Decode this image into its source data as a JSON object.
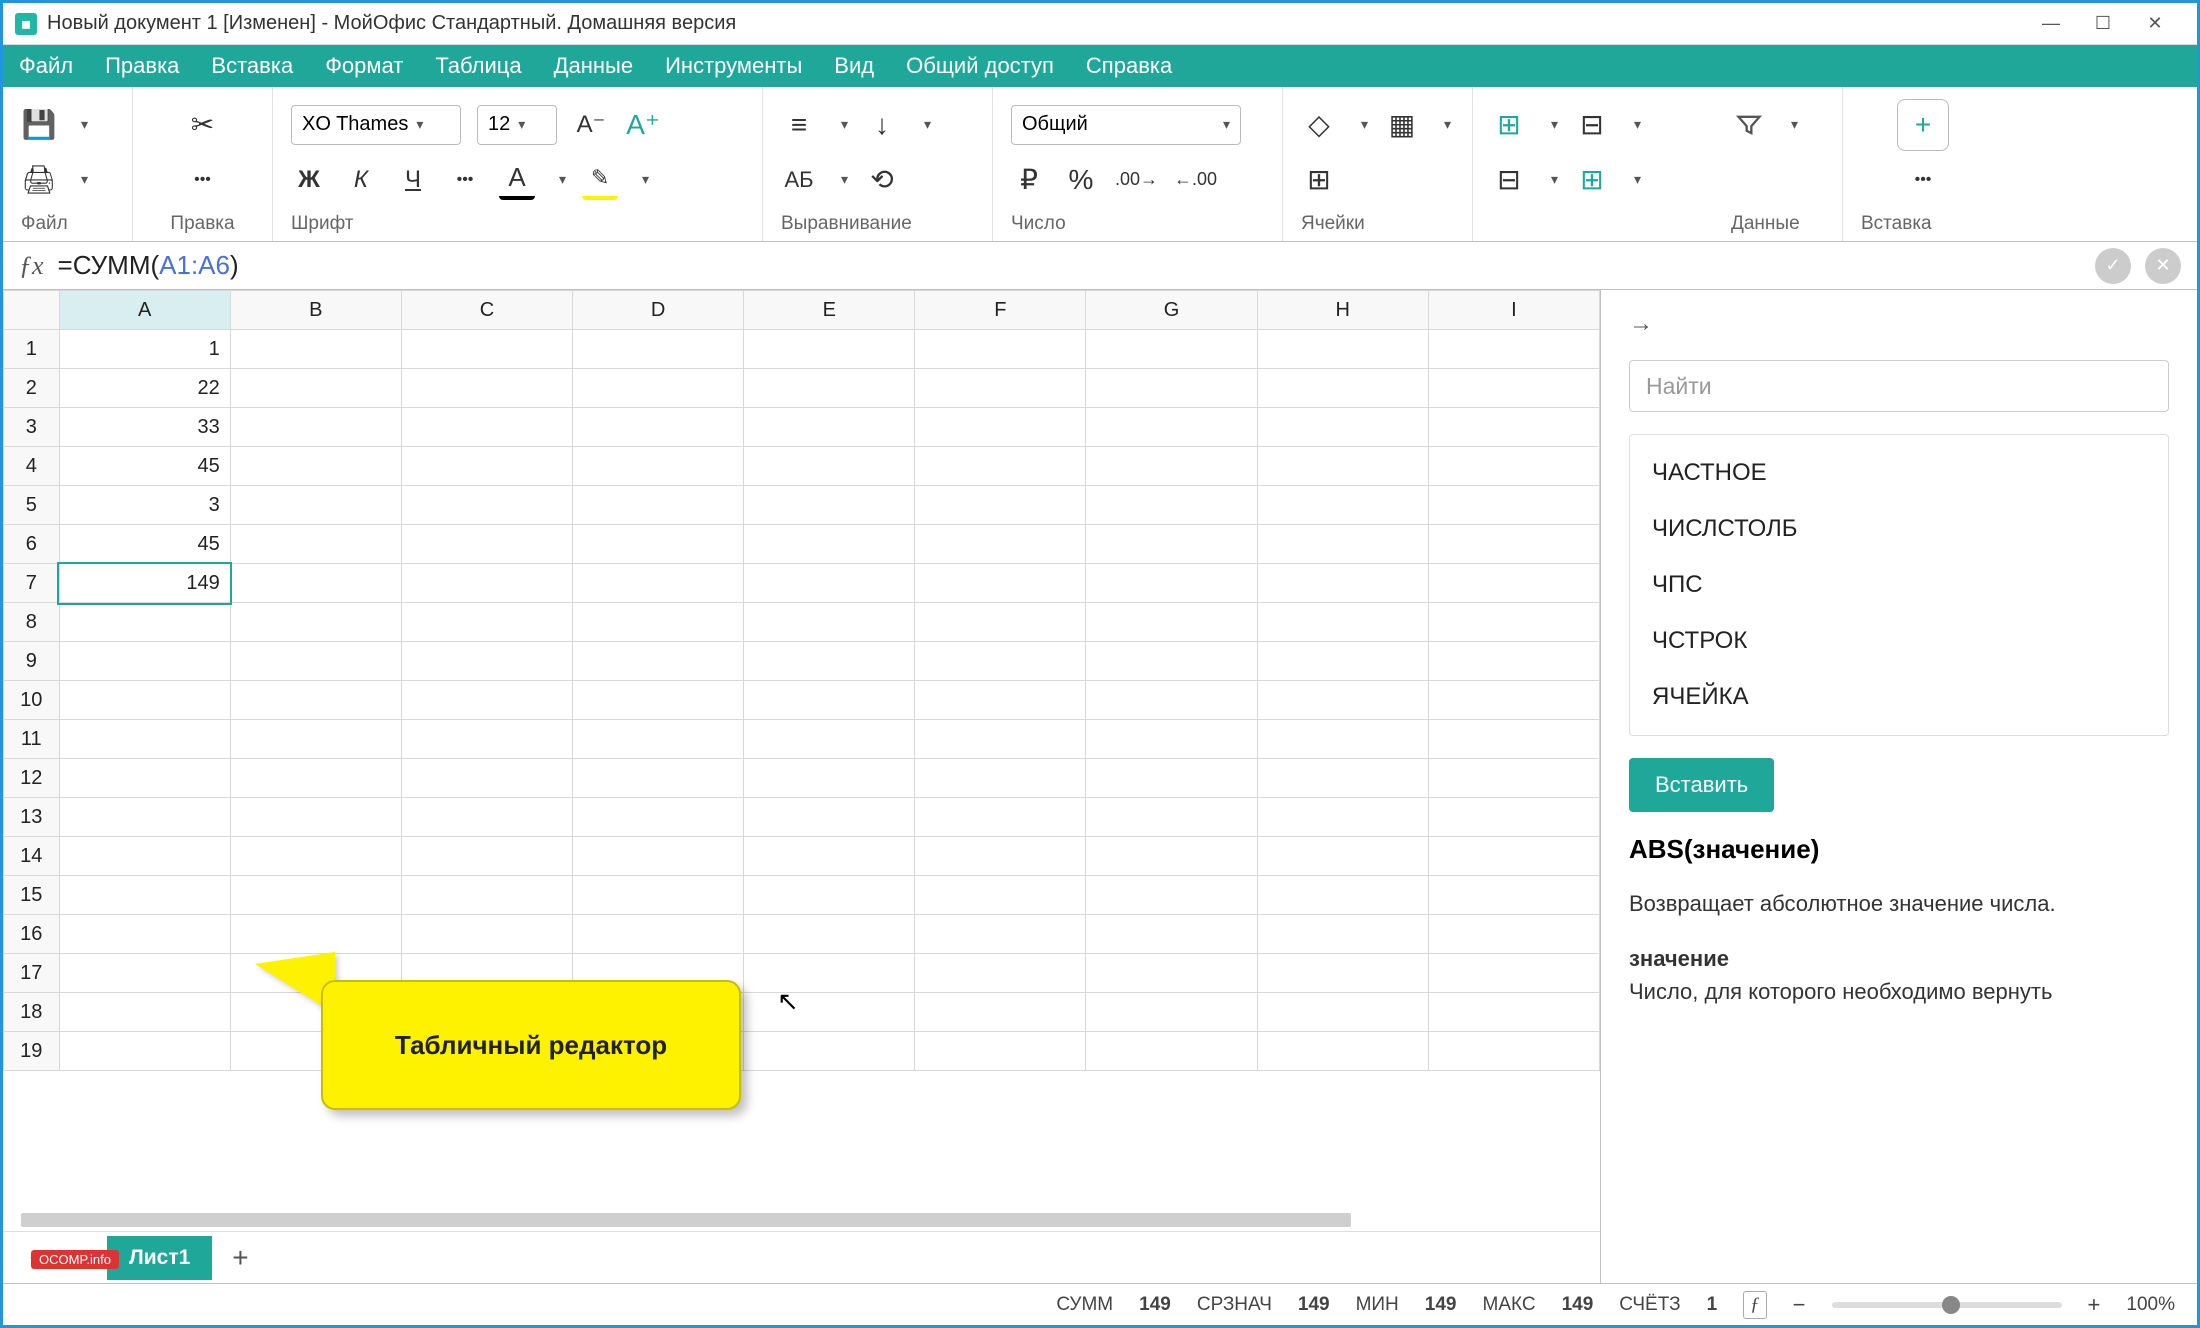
{
  "title": "Новый документ 1 [Изменен] - МойОфис Стандартный. Домашняя версия",
  "menu": [
    "Файл",
    "Правка",
    "Вставка",
    "Формат",
    "Таблица",
    "Данные",
    "Инструменты",
    "Вид",
    "Общий доступ",
    "Справка"
  ],
  "toolbar": {
    "groups": {
      "file": "Файл",
      "edit": "Правка",
      "font": "Шрифт",
      "align": "Выравнивание",
      "number": "Число",
      "cells": "Ячейки",
      "data": "Данные",
      "insert": "Вставка"
    },
    "font_name": "XO Thames",
    "font_size": "12",
    "number_format": "Общий"
  },
  "formula": {
    "prefix": "=СУММ(",
    "ref": "A1:A6",
    "suffix": ")"
  },
  "columns": [
    "A",
    "B",
    "C",
    "D",
    "E",
    "F",
    "G",
    "H",
    "I"
  ],
  "rows": 19,
  "cell_data": {
    "A1": "1",
    "A2": "22",
    "A3": "33",
    "A4": "45",
    "A5": "3",
    "A6": "45",
    "A7": "149"
  },
  "selected_cell": "A7",
  "callout": "Табличный редактор",
  "sheet_tab": "Лист1",
  "side": {
    "search_placeholder": "Найти",
    "functions": [
      "ЧАСТНОЕ",
      "ЧИСЛСТОЛБ",
      "ЧПС",
      "ЧСТРОК",
      "ЯЧЕЙКА"
    ],
    "insert_label": "Вставить",
    "help_title": "ABS(значение)",
    "help_desc": "Возвращает абсолютное значение числа.",
    "help_param": "значение",
    "help_param_desc": "Число, для которого необходимо вернуть"
  },
  "status": {
    "sum_l": "СУММ",
    "sum_v": "149",
    "avg_l": "СРЗНАЧ",
    "avg_v": "149",
    "min_l": "МИН",
    "min_v": "149",
    "max_l": "МАКС",
    "max_v": "149",
    "cnt_l": "СЧЁТЗ",
    "cnt_v": "1",
    "zoom": "100%"
  },
  "watermark": "OCOMP.info"
}
